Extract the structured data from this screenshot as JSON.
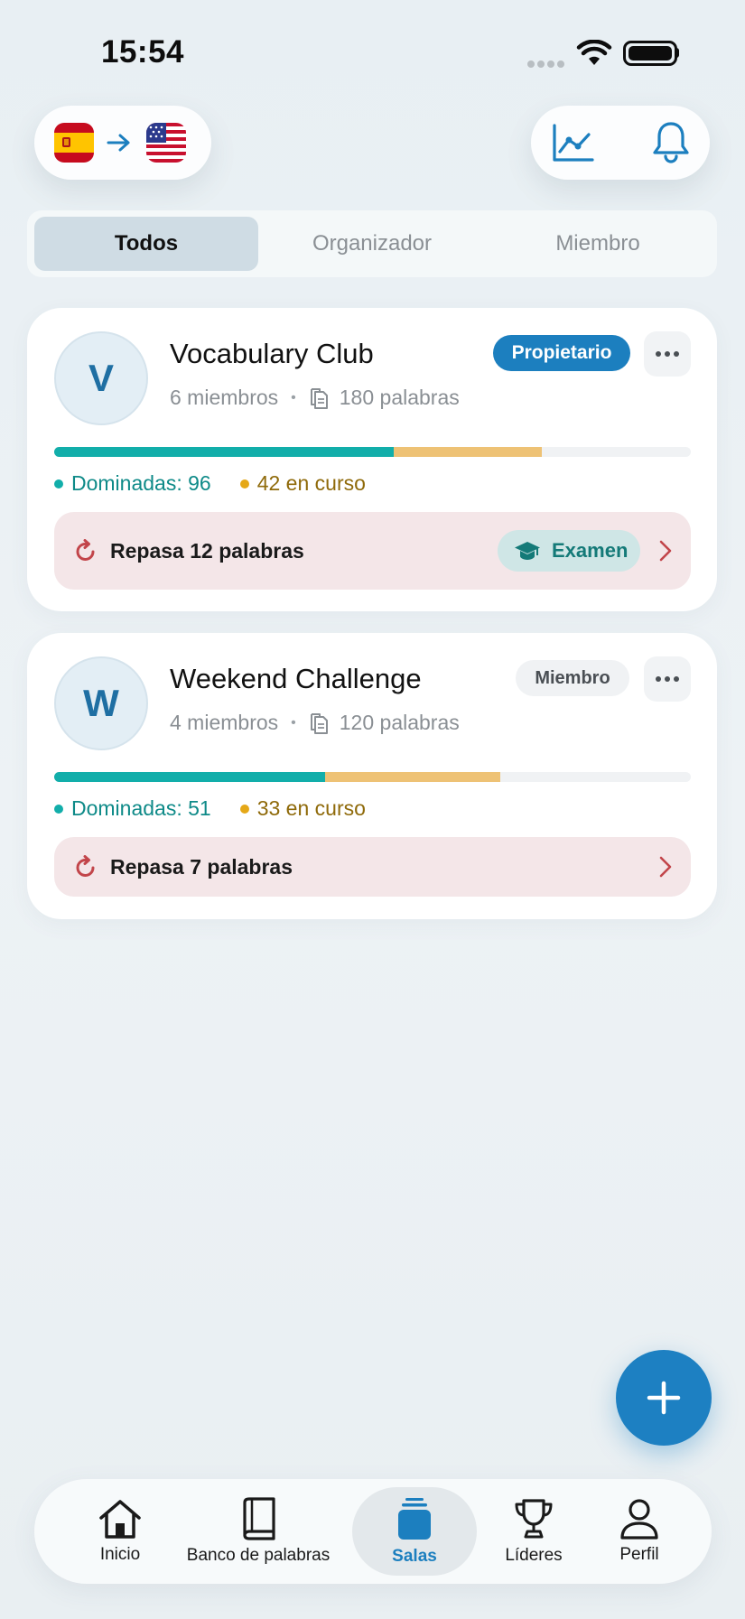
{
  "status_bar": {
    "time": "15:54"
  },
  "language": {
    "from": "Spanish",
    "to": "English (US)",
    "from_flag": "spain-flag-icon",
    "to_flag": "usa-flag-icon"
  },
  "header_actions": [
    {
      "name": "stats",
      "icon": "line-chart-icon"
    },
    {
      "name": "notifications",
      "icon": "bell-icon"
    }
  ],
  "filters": {
    "tabs": [
      "Todos",
      "Organizador",
      "Miembro"
    ],
    "selected": "Todos"
  },
  "rooms": [
    {
      "initial": "V",
      "name": "Vocabulary Club",
      "members": "6 miembros",
      "words": "180 palabras",
      "role": "Propietario",
      "mastered_label": "Dominadas: 96",
      "learning_label": "42 en curso",
      "progress": {
        "mastered_fraction": 0.533,
        "learning_fraction": 0.233
      },
      "review_label": "Repasa 12 palabras",
      "exam_label": "Examen"
    },
    {
      "initial": "W",
      "name": "Weekend Challenge",
      "members": "4 miembros",
      "words": "120 palabras",
      "role": "Miembro",
      "mastered_label": "Dominadas: 51",
      "learning_label": "33 en curso",
      "progress": {
        "mastered_fraction": 0.425,
        "learning_fraction": 0.275
      },
      "review_label": "Repasa 7 palabras"
    }
  ],
  "tab_bar": {
    "items": [
      "Inicio",
      "Banco de palabras",
      "Salas",
      "Líderes",
      "Perfil"
    ],
    "selected": "Salas"
  },
  "colors": {
    "accent": "#1c7fbf",
    "mastered": "#12aeaa",
    "learning": "#eec275",
    "review_bg": "#f4e6e8"
  }
}
